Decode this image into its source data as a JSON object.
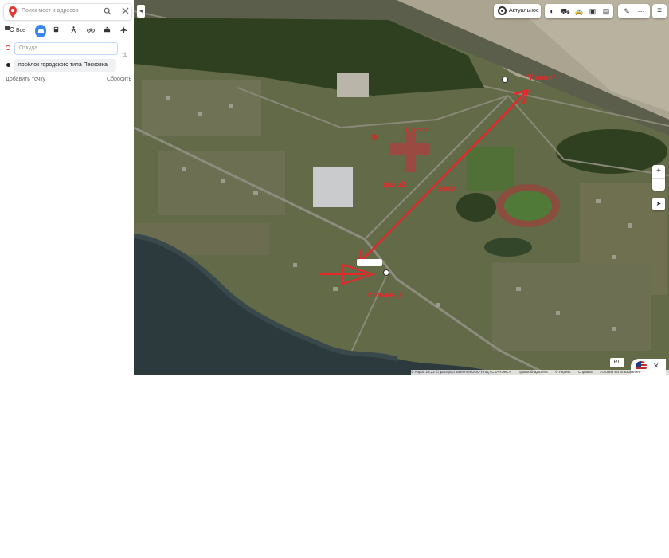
{
  "search": {
    "placeholder": "Поиск мест и адресов"
  },
  "route_modes": [
    {
      "name": "all",
      "label": "Все"
    },
    {
      "name": "car"
    },
    {
      "name": "transit"
    },
    {
      "name": "walk"
    },
    {
      "name": "bike"
    },
    {
      "name": "taxi"
    },
    {
      "name": "plane"
    }
  ],
  "route": {
    "from_placeholder": "Откуда",
    "to_value": "посёлок городского типа Песковка",
    "add_point": "Добавить точку",
    "reset": "Сбросить"
  },
  "map_controls": {
    "layer_label": "Актуальное",
    "lang": "Ru",
    "zoom_in": "+",
    "zoom_out": "−"
  },
  "annotations": {
    "station": "\"Пиони\"",
    "school": "Школа",
    "photo": "фото2",
    "distance": "580М",
    "hospital": "больница"
  },
  "copyright": {
    "text": "© Аэрос 25.22 ©, распространяется ООО НПЦ «СКАНЭКС»",
    "terms_link": "Правообладатель",
    "yandex": "© Яндекс",
    "help": "Справка",
    "terms": "Условия использования"
  },
  "colors": {
    "accent": "#3b87f0",
    "annotation_red": "#e8272a",
    "panel_bg": "#ffffff"
  }
}
